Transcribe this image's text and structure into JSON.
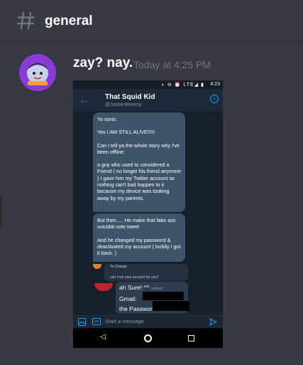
{
  "channel": {
    "name": "general",
    "icon": "hash-icon"
  },
  "message": {
    "author": "zay? nay.",
    "timestamp": "Today at 4:25 PM"
  },
  "attachment": {
    "status_bar": {
      "time": "4:23",
      "icons": "◐ ⊖ ⏰ LTE◢ ▮"
    },
    "dm_header": {
      "name": "That Squid Kid",
      "handle": "@JustanWoomy"
    },
    "bubbles": [
      {
        "paragraphs": [
          "Yo sonic",
          "Yes I AM STILL ALIVE!!!!!",
          "Can I tell ya the whole story why I've been offline:",
          "a guy who used to considered a Friend ( no longer his friend anymore ) I gave him my Twitter account so nothing can't bad happen to it because my device was tooking away by my parents."
        ]
      },
      {
        "paragraphs": [
          "But then..... He make that fake ass suicidal note tweet",
          "And he changed my password & deactivated my account ( luckily I got it back. )"
        ]
      }
    ],
    "quote": {
      "user": "Yo Orange",
      "text": "can I run your account for you?"
    },
    "reply": {
      "line1": "ah Sure! ^^",
      "edited": "(edited)",
      "line2": "Gmail:",
      "line3": "the Password"
    },
    "composer": {
      "placeholder": "Start a message",
      "gif_label": "GIF"
    }
  },
  "colors": {
    "twitter_blue": "#1da1f2",
    "bubble": "#3e5569",
    "discord_bg": "#36393f"
  }
}
